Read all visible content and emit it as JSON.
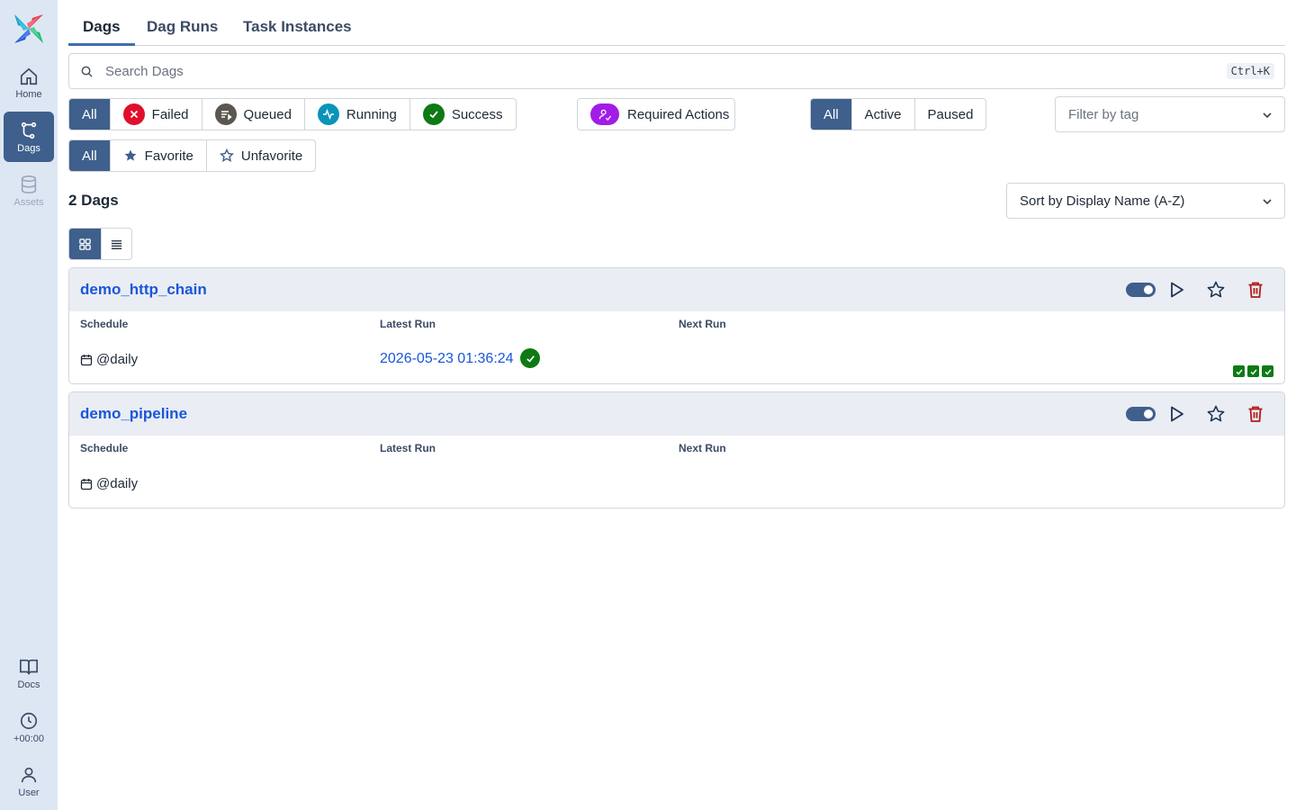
{
  "sidebar": {
    "home_label": "Home",
    "dags_label": "Dags",
    "assets_label": "Assets",
    "docs_label": "Docs",
    "timezone_label": "+00:00",
    "user_label": "User"
  },
  "tabs": [
    "Dags",
    "Dag Runs",
    "Task Instances"
  ],
  "search": {
    "placeholder": "Search Dags",
    "shortcut": "Ctrl+K"
  },
  "state_filters": [
    "All",
    "Failed",
    "Queued",
    "Running",
    "Success"
  ],
  "required_actions_label": "Required Actions",
  "active_filters": [
    "All",
    "Active",
    "Paused"
  ],
  "tag_filter_placeholder": "Filter by tag",
  "favorite_filters": [
    "All",
    "Favorite",
    "Unfavorite"
  ],
  "dag_count": "2 Dags",
  "sort_label": "Sort by Display Name (A-Z)",
  "columns": {
    "schedule": "Schedule",
    "latest_run": "Latest Run",
    "next_run": "Next Run"
  },
  "dags": [
    {
      "name": "demo_http_chain",
      "schedule": "@daily",
      "latest_run": "2026-05-23 01:36:24",
      "latest_run_state": "success",
      "recent_runs": [
        "success",
        "success",
        "success"
      ]
    },
    {
      "name": "demo_pipeline",
      "schedule": "@daily",
      "latest_run": "",
      "recent_runs": []
    }
  ],
  "colors": {
    "accent": "#3f5f8c",
    "link": "#1a56db",
    "failed": "#e0102a",
    "queued": "#5b5750",
    "running": "#0894b8",
    "success": "#0d7a13",
    "required_actions": "#a21ce6",
    "delete": "#b31b1b"
  }
}
